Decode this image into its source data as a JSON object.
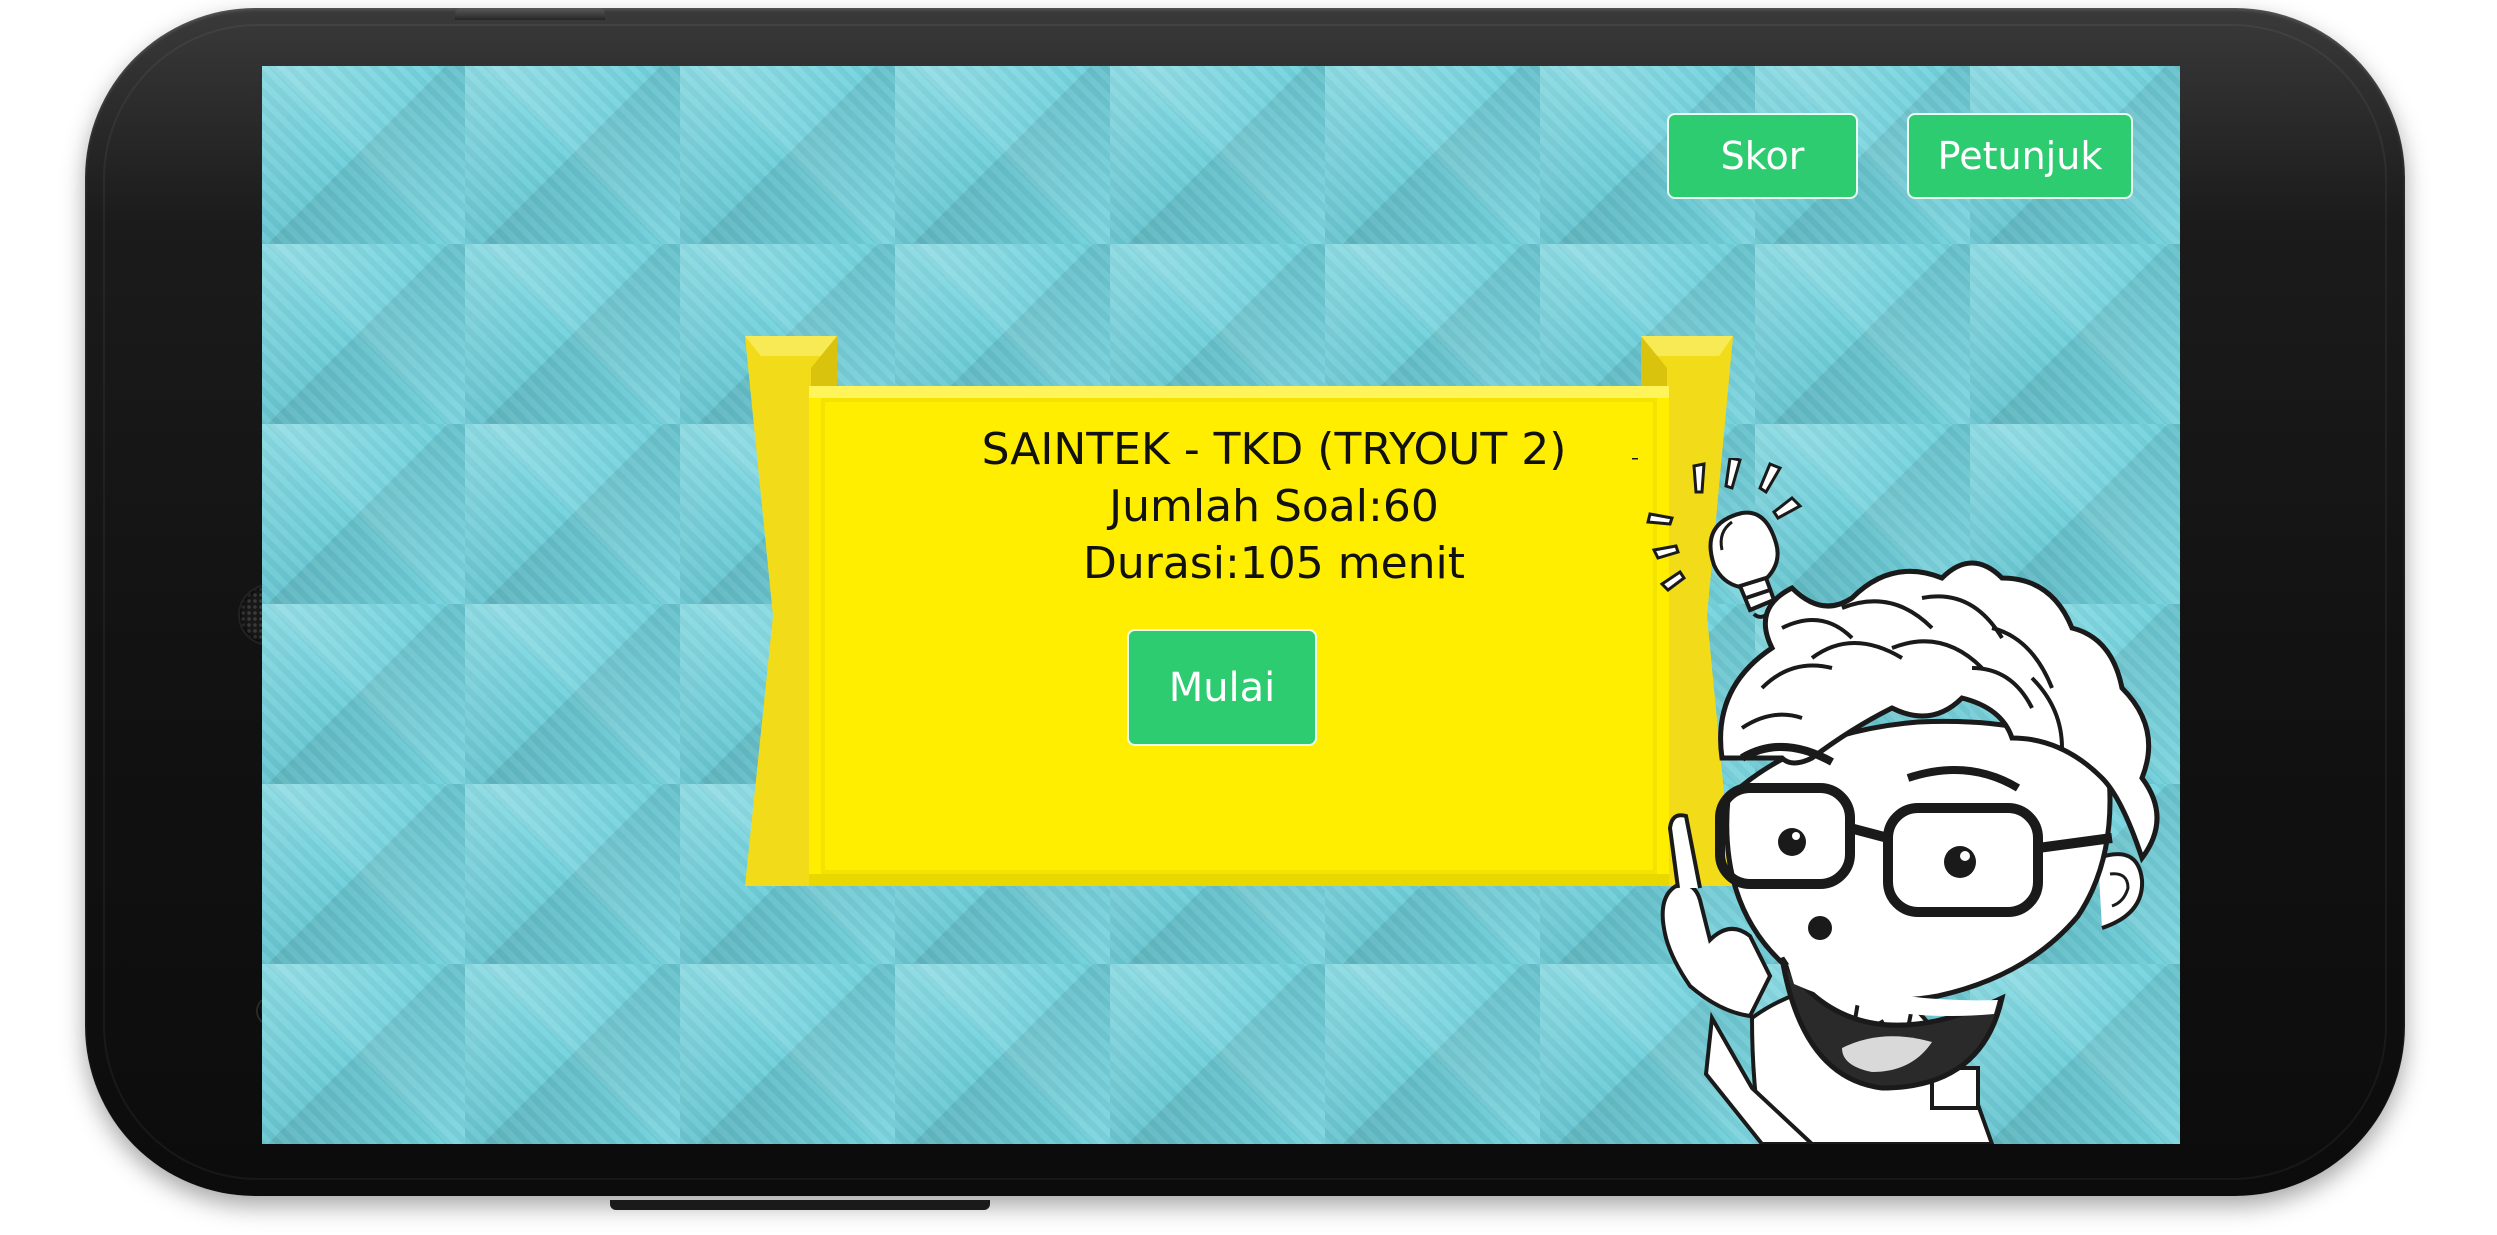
{
  "top_bar": {
    "score_button": "Skor",
    "help_button": "Petunjuk"
  },
  "quiz_card": {
    "title": "SAINTEK - TKD (TRYOUT 2)",
    "question_count": "Jumlah Soal:60",
    "duration": "Durasi:105 menit",
    "start_button": "Mulai"
  },
  "colors": {
    "background": "#6ed1dc",
    "banner": "#ffee00",
    "button": "#2ecc71",
    "phone_body": "#121212"
  },
  "icons": {
    "character": "idea-boy-illustration",
    "bulb": "lightbulb-icon"
  }
}
